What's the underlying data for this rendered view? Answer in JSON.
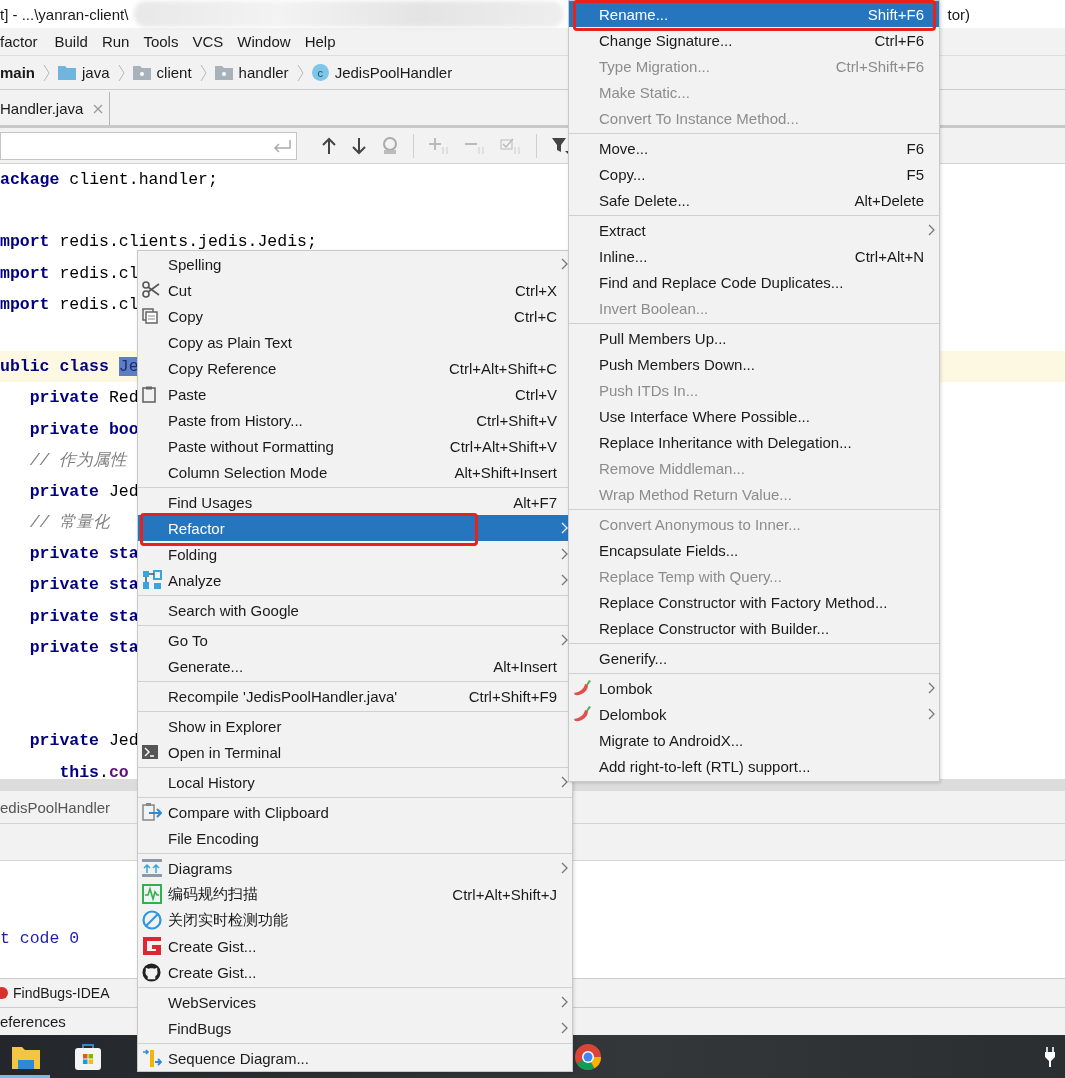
{
  "window": {
    "title_left": "t] - ...\\yanran-client\\",
    "title_right": "tor)"
  },
  "menu_bar": [
    "factor",
    "Build",
    "Run",
    "Tools",
    "VCS",
    "Window",
    "Help"
  ],
  "breadcrumb": [
    {
      "label": "main",
      "kind": "module"
    },
    {
      "label": "java",
      "kind": "source-folder"
    },
    {
      "label": "client",
      "kind": "package"
    },
    {
      "label": "handler",
      "kind": "package"
    },
    {
      "label": "JedisPoolHandler",
      "kind": "class",
      "badge": "c"
    }
  ],
  "editor_tab": {
    "label": "Handler.java"
  },
  "code_lines": [
    {
      "kind": "code",
      "highlighted": false,
      "segments": [
        {
          "text": "ackage",
          "kind": "keyword"
        },
        {
          "text": " client.handler;",
          "kind": "plain"
        }
      ]
    },
    {
      "kind": "blank",
      "highlighted": false
    },
    {
      "kind": "code",
      "highlighted": false,
      "segments": [
        {
          "text": "mport",
          "kind": "keyword"
        },
        {
          "text": " redis.clients.jedis.Jedis;",
          "kind": "plain"
        }
      ]
    },
    {
      "kind": "code",
      "highlighted": false,
      "segments": [
        {
          "text": "mport",
          "kind": "keyword"
        },
        {
          "text": " redis.cl",
          "kind": "plain"
        }
      ]
    },
    {
      "kind": "code",
      "highlighted": false,
      "segments": [
        {
          "text": "mport",
          "kind": "keyword"
        },
        {
          "text": " redis.cl",
          "kind": "plain"
        }
      ]
    },
    {
      "kind": "blank",
      "highlighted": false
    },
    {
      "kind": "code",
      "highlighted": true,
      "segments": [
        {
          "text": "ublic class ",
          "kind": "keyword"
        },
        {
          "text": "Je",
          "kind": "selection"
        }
      ]
    },
    {
      "kind": "code",
      "highlighted": false,
      "segments": [
        {
          "text": "   private",
          "kind": "keyword"
        },
        {
          "text": " Red",
          "kind": "plain"
        }
      ]
    },
    {
      "kind": "code",
      "highlighted": false,
      "segments": [
        {
          "text": "   private boo",
          "kind": "keyword"
        }
      ]
    },
    {
      "kind": "code",
      "highlighted": false,
      "segments": [
        {
          "text": "   // 作为属性",
          "kind": "comment"
        }
      ]
    },
    {
      "kind": "code",
      "highlighted": false,
      "segments": [
        {
          "text": "   private",
          "kind": "keyword"
        },
        {
          "text": " Jed",
          "kind": "plain"
        }
      ]
    },
    {
      "kind": "code",
      "highlighted": false,
      "segments": [
        {
          "text": "   // 常量化",
          "kind": "comment"
        }
      ]
    },
    {
      "kind": "code",
      "highlighted": false,
      "segments": [
        {
          "text": "   private sta",
          "kind": "keyword"
        }
      ]
    },
    {
      "kind": "code",
      "highlighted": false,
      "segments": [
        {
          "text": "   private sta",
          "kind": "keyword"
        }
      ]
    },
    {
      "kind": "code",
      "highlighted": false,
      "segments": [
        {
          "text": "   private sta",
          "kind": "keyword"
        }
      ]
    },
    {
      "kind": "code",
      "highlighted": false,
      "segments": [
        {
          "text": "   private sta",
          "kind": "keyword"
        }
      ]
    },
    {
      "kind": "blank",
      "highlighted": false
    },
    {
      "kind": "blank",
      "highlighted": false
    },
    {
      "kind": "code",
      "highlighted": false,
      "segments": [
        {
          "text": "   private",
          "kind": "keyword"
        },
        {
          "text": " Jed",
          "kind": "plain"
        }
      ]
    },
    {
      "kind": "code",
      "highlighted": false,
      "segments": [
        {
          "text": "      this",
          "kind": "keyword"
        },
        {
          "text": ".",
          "kind": "plain"
        },
        {
          "text": "co",
          "kind": "field"
        }
      ]
    }
  ],
  "tool_window": {
    "title": "edisPoolHandler",
    "output": "t code 0"
  },
  "findbugs_tab": {
    "label": "FindBugs-IDEA"
  },
  "status_tab": {
    "label": "eferences"
  },
  "context_menu": {
    "items": [
      {
        "kind": "item",
        "label": "Spelling",
        "submenu": true,
        "disabled": false,
        "selected": false,
        "outlined": false
      },
      {
        "kind": "item",
        "label": "Cut",
        "shortcut": "Ctrl+X",
        "submenu": false,
        "disabled": false,
        "selected": false,
        "outlined": false
      },
      {
        "kind": "item",
        "label": "Copy",
        "shortcut": "Ctrl+C",
        "submenu": false,
        "disabled": false,
        "selected": false,
        "outlined": false
      },
      {
        "kind": "item",
        "label": "Copy as Plain Text",
        "submenu": false,
        "disabled": false,
        "selected": false,
        "outlined": false
      },
      {
        "kind": "item",
        "label": "Copy Reference",
        "shortcut": "Ctrl+Alt+Shift+C",
        "submenu": false,
        "disabled": false,
        "selected": false,
        "outlined": false
      },
      {
        "kind": "item",
        "label": "Paste",
        "shortcut": "Ctrl+V",
        "submenu": false,
        "disabled": false,
        "selected": false,
        "outlined": false
      },
      {
        "kind": "item",
        "label": "Paste from History...",
        "shortcut": "Ctrl+Shift+V",
        "submenu": false,
        "disabled": false,
        "selected": false,
        "outlined": false
      },
      {
        "kind": "item",
        "label": "Paste without Formatting",
        "shortcut": "Ctrl+Alt+Shift+V",
        "submenu": false,
        "disabled": false,
        "selected": false,
        "outlined": false
      },
      {
        "kind": "item",
        "label": "Column Selection Mode",
        "shortcut": "Alt+Shift+Insert",
        "submenu": false,
        "disabled": false,
        "selected": false,
        "outlined": false
      },
      {
        "kind": "separator"
      },
      {
        "kind": "item",
        "label": "Find Usages",
        "shortcut": "Alt+F7",
        "submenu": false,
        "disabled": false,
        "selected": false,
        "outlined": false
      },
      {
        "kind": "item",
        "label": "Refactor",
        "submenu": true,
        "disabled": false,
        "selected": true,
        "outlined": true
      },
      {
        "kind": "item",
        "label": "Folding",
        "submenu": true,
        "disabled": false,
        "selected": false,
        "outlined": false
      },
      {
        "kind": "item",
        "label": "Analyze",
        "submenu": true,
        "disabled": false,
        "selected": false,
        "outlined": false
      },
      {
        "kind": "separator"
      },
      {
        "kind": "item",
        "label": "Search with Google",
        "submenu": false,
        "disabled": false,
        "selected": false,
        "outlined": false
      },
      {
        "kind": "separator"
      },
      {
        "kind": "item",
        "label": "Go To",
        "submenu": true,
        "disabled": false,
        "selected": false,
        "outlined": false
      },
      {
        "kind": "item",
        "label": "Generate...",
        "shortcut": "Alt+Insert",
        "submenu": false,
        "disabled": false,
        "selected": false,
        "outlined": false
      },
      {
        "kind": "separator"
      },
      {
        "kind": "item",
        "label": "Recompile 'JedisPoolHandler.java'",
        "shortcut": "Ctrl+Shift+F9",
        "submenu": false,
        "disabled": false,
        "selected": false,
        "outlined": false
      },
      {
        "kind": "separator"
      },
      {
        "kind": "item",
        "label": "Show in Explorer",
        "submenu": false,
        "disabled": false,
        "selected": false,
        "outlined": false
      },
      {
        "kind": "item",
        "label": "Open in Terminal",
        "submenu": false,
        "disabled": false,
        "selected": false,
        "outlined": false
      },
      {
        "kind": "separator"
      },
      {
        "kind": "item",
        "label": "Local History",
        "submenu": true,
        "disabled": false,
        "selected": false,
        "outlined": false
      },
      {
        "kind": "separator"
      },
      {
        "kind": "item",
        "label": "Compare with Clipboard",
        "submenu": false,
        "disabled": false,
        "selected": false,
        "outlined": false
      },
      {
        "kind": "item",
        "label": "File Encoding",
        "submenu": false,
        "disabled": false,
        "selected": false,
        "outlined": false
      },
      {
        "kind": "separator"
      },
      {
        "kind": "item",
        "label": "Diagrams",
        "submenu": true,
        "disabled": false,
        "selected": false,
        "outlined": false
      },
      {
        "kind": "item",
        "label": "编码规约扫描",
        "shortcut": "Ctrl+Alt+Shift+J",
        "submenu": false,
        "disabled": false,
        "selected": false,
        "outlined": false
      },
      {
        "kind": "item",
        "label": "关闭实时检测功能",
        "submenu": false,
        "disabled": false,
        "selected": false,
        "outlined": false
      },
      {
        "kind": "item",
        "label": "Create Gist...",
        "submenu": false,
        "disabled": false,
        "selected": false,
        "outlined": false
      },
      {
        "kind": "item",
        "label": "Create Gist...",
        "submenu": false,
        "disabled": false,
        "selected": false,
        "outlined": false
      },
      {
        "kind": "separator"
      },
      {
        "kind": "item",
        "label": "WebServices",
        "submenu": true,
        "disabled": false,
        "selected": false,
        "outlined": false
      },
      {
        "kind": "item",
        "label": "FindBugs",
        "submenu": true,
        "disabled": false,
        "selected": false,
        "outlined": false
      },
      {
        "kind": "separator"
      },
      {
        "kind": "item",
        "label": "Sequence Diagram...",
        "submenu": false,
        "disabled": false,
        "selected": false,
        "outlined": false
      }
    ]
  },
  "refactor_submenu": {
    "items": [
      {
        "kind": "item",
        "label": "Rename...",
        "shortcut": "Shift+F6",
        "submenu": false,
        "disabled": false,
        "selected": true,
        "outlined": true
      },
      {
        "kind": "item",
        "label": "Change Signature...",
        "shortcut": "Ctrl+F6",
        "submenu": false,
        "disabled": false,
        "selected": false,
        "outlined": false
      },
      {
        "kind": "item",
        "label": "Type Migration...",
        "shortcut": "Ctrl+Shift+F6",
        "submenu": false,
        "disabled": true,
        "selected": false,
        "outlined": false
      },
      {
        "kind": "item",
        "label": "Make Static...",
        "submenu": false,
        "disabled": true,
        "selected": false,
        "outlined": false
      },
      {
        "kind": "item",
        "label": "Convert To Instance Method...",
        "submenu": false,
        "disabled": true,
        "selected": false,
        "outlined": false
      },
      {
        "kind": "separator"
      },
      {
        "kind": "item",
        "label": "Move...",
        "shortcut": "F6",
        "submenu": false,
        "disabled": false,
        "selected": false,
        "outlined": false
      },
      {
        "kind": "item",
        "label": "Copy...",
        "shortcut": "F5",
        "submenu": false,
        "disabled": false,
        "selected": false,
        "outlined": false
      },
      {
        "kind": "item",
        "label": "Safe Delete...",
        "shortcut": "Alt+Delete",
        "submenu": false,
        "disabled": false,
        "selected": false,
        "outlined": false
      },
      {
        "kind": "separator"
      },
      {
        "kind": "item",
        "label": "Extract",
        "submenu": true,
        "disabled": false,
        "selected": false,
        "outlined": false
      },
      {
        "kind": "item",
        "label": "Inline...",
        "shortcut": "Ctrl+Alt+N",
        "submenu": false,
        "disabled": false,
        "selected": false,
        "outlined": false
      },
      {
        "kind": "item",
        "label": "Find and Replace Code Duplicates...",
        "submenu": false,
        "disabled": false,
        "selected": false,
        "outlined": false
      },
      {
        "kind": "item",
        "label": "Invert Boolean...",
        "submenu": false,
        "disabled": true,
        "selected": false,
        "outlined": false
      },
      {
        "kind": "separator"
      },
      {
        "kind": "item",
        "label": "Pull Members Up...",
        "submenu": false,
        "disabled": false,
        "selected": false,
        "outlined": false
      },
      {
        "kind": "item",
        "label": "Push Members Down...",
        "submenu": false,
        "disabled": false,
        "selected": false,
        "outlined": false
      },
      {
        "kind": "item",
        "label": "Push ITDs In...",
        "submenu": false,
        "disabled": true,
        "selected": false,
        "outlined": false
      },
      {
        "kind": "item",
        "label": "Use Interface Where Possible...",
        "submenu": false,
        "disabled": false,
        "selected": false,
        "outlined": false
      },
      {
        "kind": "item",
        "label": "Replace Inheritance with Delegation...",
        "submenu": false,
        "disabled": false,
        "selected": false,
        "outlined": false
      },
      {
        "kind": "item",
        "label": "Remove Middleman...",
        "submenu": false,
        "disabled": true,
        "selected": false,
        "outlined": false
      },
      {
        "kind": "item",
        "label": "Wrap Method Return Value...",
        "submenu": false,
        "disabled": true,
        "selected": false,
        "outlined": false
      },
      {
        "kind": "separator"
      },
      {
        "kind": "item",
        "label": "Convert Anonymous to Inner...",
        "submenu": false,
        "disabled": true,
        "selected": false,
        "outlined": false
      },
      {
        "kind": "item",
        "label": "Encapsulate Fields...",
        "submenu": false,
        "disabled": false,
        "selected": false,
        "outlined": false
      },
      {
        "kind": "item",
        "label": "Replace Temp with Query...",
        "submenu": false,
        "disabled": true,
        "selected": false,
        "outlined": false
      },
      {
        "kind": "item",
        "label": "Replace Constructor with Factory Method...",
        "submenu": false,
        "disabled": false,
        "selected": false,
        "outlined": false
      },
      {
        "kind": "item",
        "label": "Replace Constructor with Builder...",
        "submenu": false,
        "disabled": false,
        "selected": false,
        "outlined": false
      },
      {
        "kind": "separator"
      },
      {
        "kind": "item",
        "label": "Generify...",
        "submenu": false,
        "disabled": false,
        "selected": false,
        "outlined": false
      },
      {
        "kind": "separator"
      },
      {
        "kind": "item",
        "label": "Lombok",
        "submenu": true,
        "disabled": false,
        "selected": false,
        "outlined": false
      },
      {
        "kind": "item",
        "label": "Delombok",
        "submenu": true,
        "disabled": false,
        "selected": false,
        "outlined": false
      },
      {
        "kind": "item",
        "label": "Migrate to AndroidX...",
        "submenu": false,
        "disabled": false,
        "selected": false,
        "outlined": false
      },
      {
        "kind": "item",
        "label": "Add right-to-left (RTL) support...",
        "submenu": false,
        "disabled": false,
        "selected": false,
        "outlined": false
      }
    ]
  }
}
